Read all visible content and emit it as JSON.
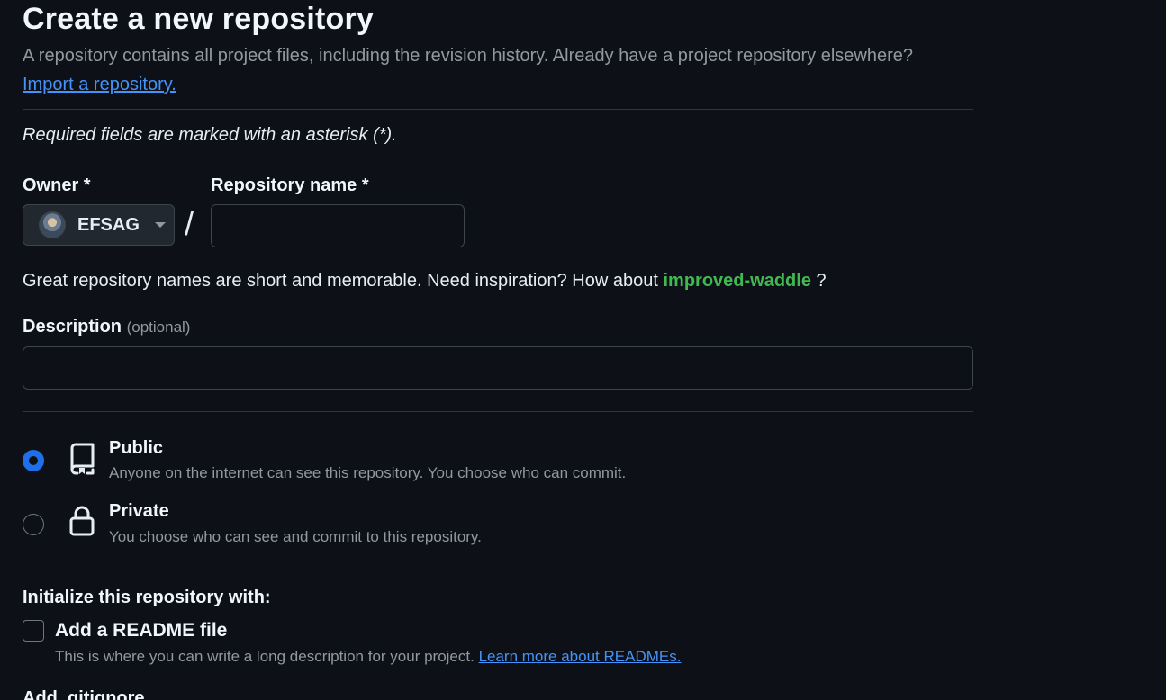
{
  "header": {
    "title": "Create a new repository",
    "subtitle": "A repository contains all project files, including the revision history. Already have a project repository elsewhere?",
    "import_link": "Import a repository."
  },
  "form": {
    "required_note": "Required fields are marked with an asterisk (*).",
    "owner": {
      "label": "Owner *",
      "value": "EFSAG"
    },
    "separator": "/",
    "repo_name": {
      "label": "Repository name *",
      "value": "",
      "placeholder": ""
    },
    "hint": {
      "prefix": "Great repository names are short and memorable. Need inspiration? How about",
      "suggestion": "improved-waddle",
      "suffix": "?"
    },
    "description": {
      "label": "Description",
      "optional": "(optional)",
      "value": "",
      "placeholder": ""
    },
    "visibility": {
      "selected": "Public",
      "options": [
        {
          "title": "Public",
          "description": "Anyone on the internet can see this repository. You choose who can commit.",
          "icon": "repo-icon",
          "checked": true
        },
        {
          "title": "Private",
          "description": "You choose who can see and commit to this repository.",
          "icon": "lock-icon",
          "checked": false
        }
      ]
    },
    "initialize": {
      "heading": "Initialize this repository with:",
      "readme": {
        "label": "Add a README file",
        "description": "This is where you can write a long description for your project.",
        "link": "Learn more about READMEs.",
        "checked": false
      }
    },
    "next_heading_partial": "Add .gitignore"
  },
  "colors": {
    "background": "#0d1117",
    "link": "#4493f8",
    "suggestion": "#3fb950",
    "radio_checked": "#1f6feb",
    "border": "#30363d"
  }
}
